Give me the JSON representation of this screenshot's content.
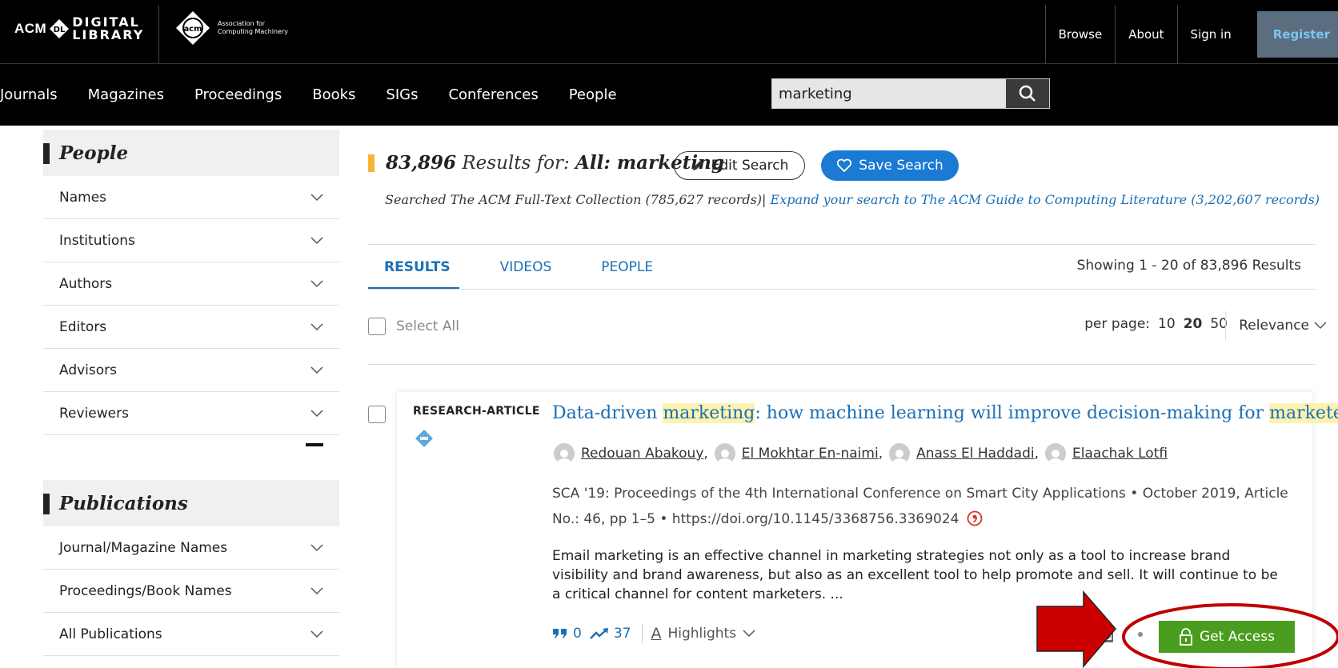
{
  "header": {
    "acm_dl_left": "ACM",
    "acm_dl_top": "DIGITAL",
    "acm_dl_bottom": "LIBRARY",
    "dl_badge": "DL",
    "assoc_badge": "acm",
    "assoc_line1": "Association for",
    "assoc_line2": "Computing Machinery",
    "links": [
      "Browse",
      "About",
      "Sign in"
    ],
    "register": "Register"
  },
  "nav": {
    "items": [
      "Journals",
      "Magazines",
      "Proceedings",
      "Books",
      "SIGs",
      "Conferences",
      "People"
    ],
    "search_value": "marketing"
  },
  "sidebar": {
    "people_title": "People",
    "people_items": [
      "Names",
      "Institutions",
      "Authors",
      "Editors",
      "Advisors",
      "Reviewers"
    ],
    "publications_title": "Publications",
    "publication_items": [
      "Journal/Magazine Names",
      "Proceedings/Book Names",
      "All Publications"
    ]
  },
  "results": {
    "count": "83,896",
    "results_for": "Results for:",
    "query": "All: marketing",
    "edit_search": "Edit Search",
    "save_search": "Save Search",
    "searched": "Searched The ACM Full-Text Collection (785,627 records)|",
    "expand": "Expand your search to The ACM Guide to Computing Literature (3,202,607 records)",
    "tabs": [
      "RESULTS",
      "VIDEOS",
      "PEOPLE"
    ],
    "showing": "Showing 1 - 20  of 83,896 Results",
    "select_all": "Select All",
    "per_page_label": "per page:",
    "per_page_options": [
      "10",
      "20",
      "50"
    ],
    "sort": "Relevance"
  },
  "article": {
    "type": "RESEARCH-ARTICLE",
    "title_parts": [
      "Data-driven ",
      "marketing",
      ": how machine learning will improve decision-making for ",
      "marketers"
    ],
    "authors": [
      "Redouan Abakouy",
      "El Mokhtar En-naimi",
      "Anass El Haddadi",
      "Elaachak Lotfi"
    ],
    "pub_line1": "SCA '19: Proceedings of the 4th International Conference on Smart City Applications • October 2019, Article",
    "pub_line2": "No.: 46, pp 1–5 • https://doi.org/10.1145/3368756.3369024",
    "abstract": "Email marketing is an effective channel in marketing strategies not only as a tool to increase brand visibility and brand awareness, but also as an excellent tool to help promote and sell. It will continue to be a critical channel for content marketers. ...",
    "citations": "0",
    "downloads": "37",
    "highlights": "Highlights",
    "highlights_icon_letter": "A",
    "get_access": "Get Access"
  },
  "colors": {
    "link_blue": "#1a6fb5",
    "save_button": "#1a7ad4",
    "get_access_green": "#4a9d1e",
    "result_bar": "#f5b33b",
    "annotation_red": "#c00000"
  }
}
